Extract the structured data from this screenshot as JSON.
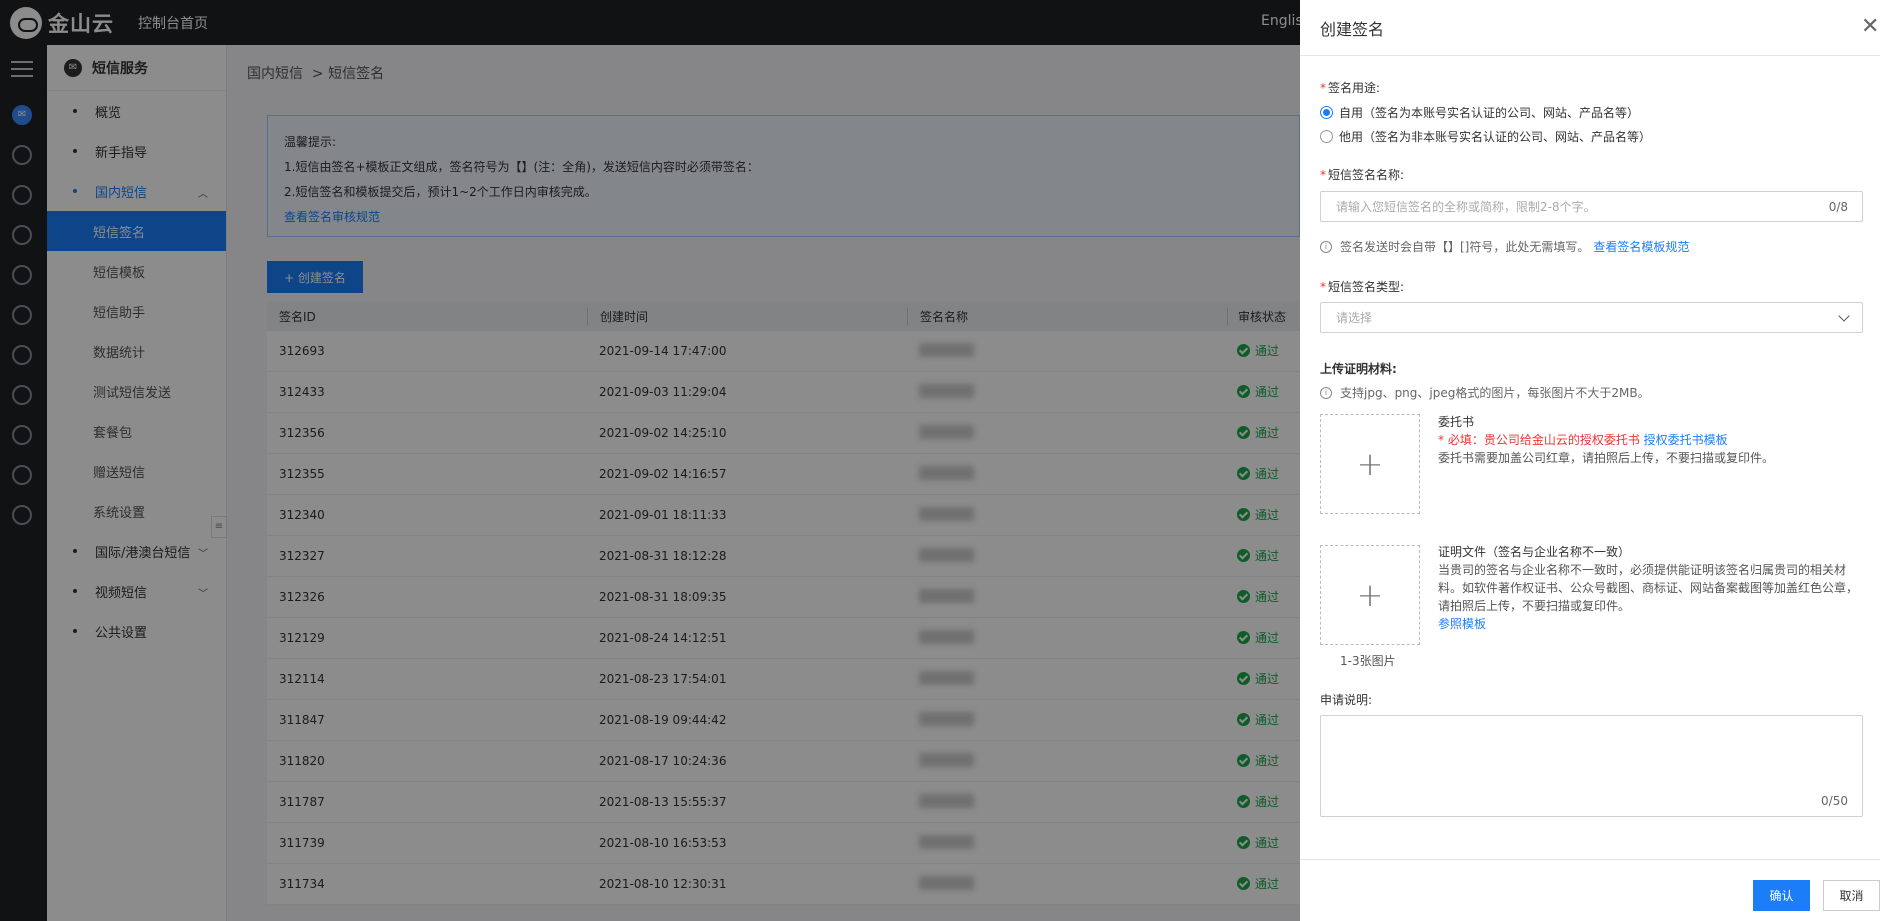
{
  "topbar": {
    "brand": "金山云",
    "console_home": "控制台首页",
    "language": "Englis"
  },
  "sidebar": {
    "service_title": "短信服务",
    "items": [
      {
        "label": "概览"
      },
      {
        "label": "新手指导"
      },
      {
        "label": "国内短信"
      },
      {
        "label": "国际/港澳台短信"
      },
      {
        "label": "视频短信"
      },
      {
        "label": "公共设置"
      }
    ],
    "sub_items": [
      {
        "label": "短信签名"
      },
      {
        "label": "短信模板"
      },
      {
        "label": "短信助手"
      },
      {
        "label": "数据统计"
      },
      {
        "label": "测试短信发送"
      },
      {
        "label": "套餐包"
      },
      {
        "label": "赠送短信"
      },
      {
        "label": "系统设置"
      }
    ]
  },
  "breadcrumb": {
    "level1": "国内短信",
    "sep": ">",
    "level2": "短信签名"
  },
  "tip": {
    "title": "温馨提示:",
    "line1": "1.短信由签名+模板正文组成，签名符号为【】(注：全角)，发送短信内容时必须带签名：",
    "line2": "2.短信签名和模板提交后，预计1~2个工作日内审核完成。",
    "link": "查看签名审核规范"
  },
  "create_button": "+ 创建签名",
  "table": {
    "headers": [
      "签名ID",
      "创建时间",
      "签名名称",
      "审核状态"
    ],
    "rows": [
      {
        "id": "312693",
        "time": "2021-09-14 17:47:00",
        "status": "通过"
      },
      {
        "id": "312433",
        "time": "2021-09-03 11:29:04",
        "status": "通过"
      },
      {
        "id": "312356",
        "time": "2021-09-02 14:25:10",
        "status": "通过"
      },
      {
        "id": "312355",
        "time": "2021-09-02 14:16:57",
        "status": "通过"
      },
      {
        "id": "312340",
        "time": "2021-09-01 18:11:33",
        "status": "通过"
      },
      {
        "id": "312327",
        "time": "2021-08-31 18:12:28",
        "status": "通过"
      },
      {
        "id": "312326",
        "time": "2021-08-31 18:09:35",
        "status": "通过"
      },
      {
        "id": "312129",
        "time": "2021-08-24 14:12:51",
        "status": "通过"
      },
      {
        "id": "312114",
        "time": "2021-08-23 17:54:01",
        "status": "通过"
      },
      {
        "id": "311847",
        "time": "2021-08-19 09:44:42",
        "status": "通过"
      },
      {
        "id": "311820",
        "time": "2021-08-17 10:24:36",
        "status": "通过"
      },
      {
        "id": "311787",
        "time": "2021-08-13 15:55:37",
        "status": "通过"
      },
      {
        "id": "311739",
        "time": "2021-08-10 16:53:53",
        "status": "通过"
      },
      {
        "id": "311734",
        "time": "2021-08-10 12:30:31",
        "status": "通过"
      }
    ]
  },
  "drawer": {
    "title": "创建签名",
    "usage_label": "签名用途:",
    "usage_self": "自用（签名为本账号实名认证的公司、网站、产品名等）",
    "usage_other": "他用（签名为非本账号实名认证的公司、网站、产品名等）",
    "name_label": "短信签名名称:",
    "name_placeholder": "请输入您短信签名的全称或简称，限制2-8个字。",
    "name_count": "0/8",
    "name_hint": "签名发送时会自带【】[]符号，此处无需填写。",
    "name_hint_link": "查看签名模板规范",
    "type_label": "短信签名类型:",
    "type_placeholder": "请选择",
    "upload_label": "上传证明材料:",
    "upload_hint": "支持jpg、png、jpeg格式的图片，每张图片不大于2MB。",
    "auth_title": "委托书",
    "auth_required": "* 必填：贵公司给金山云的授权委托书",
    "auth_link": "授权委托书模板",
    "auth_desc": "委托书需要加盖公司红章，请拍照后上传，不要扫描或复印件。",
    "proof_title": "证明文件（签名与企业名称不一致）",
    "proof_desc": "当贵司的签名与企业名称不一致时，必须提供能证明该签名归属贵司的相关材料。如软件著作权证书、公众号截图、商标证、网站备案截图等加盖红色公章，请拍照后上传，不要扫描或复印件。",
    "proof_link": "参照模板",
    "proof_caption": "1-3张图片",
    "remark_label": "申请说明:",
    "remark_count": "0/50",
    "confirm": "确认",
    "cancel": "取消"
  }
}
